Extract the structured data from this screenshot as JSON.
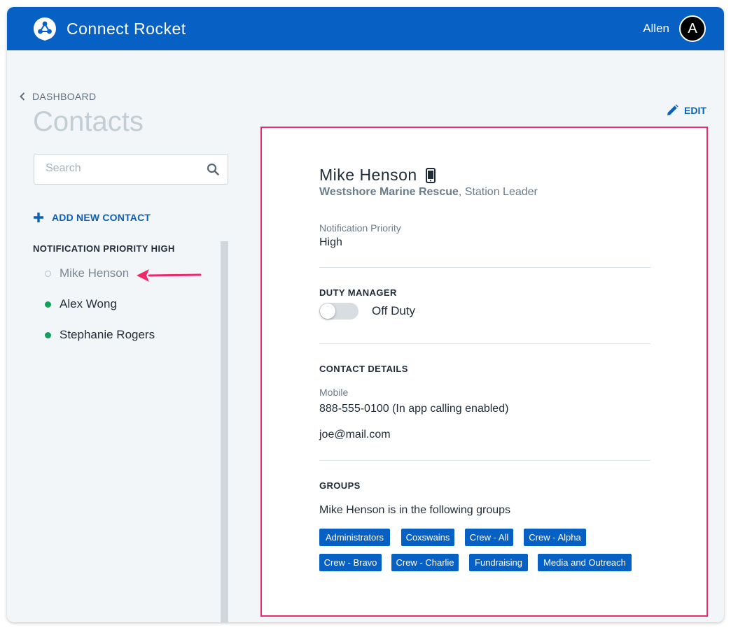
{
  "header": {
    "app_title": "Connect Rocket",
    "user_name": "Allen",
    "avatar_initial": "A",
    "brand_color": "#0760c4"
  },
  "nav": {
    "back_label": "DASHBOARD",
    "page_title": "Contacts"
  },
  "search": {
    "placeholder": "Search",
    "value": ""
  },
  "add_contact_label": "ADD NEW CONTACT",
  "contact_list": {
    "section_label": "NOTIFICATION PRIORITY HIGH",
    "items": [
      {
        "name": "Mike Henson",
        "status": "off"
      },
      {
        "name": "Alex Wong",
        "status": "on"
      },
      {
        "name": "Stephanie Rogers",
        "status": "on"
      }
    ]
  },
  "edit_label": "EDIT",
  "detail": {
    "name": "Mike Henson",
    "organization": "Westshore Marine Rescue",
    "role": ", Station Leader",
    "notification_priority_label": "Notification Priority",
    "notification_priority_value": "High",
    "duty_manager_heading": "DUTY MANAGER",
    "duty_status": "Off Duty",
    "contact_details_heading": "CONTACT DETAILS",
    "mobile_label": "Mobile",
    "mobile_value": "888-555-0100 (In app calling enabled)",
    "email": "joe@mail.com",
    "groups_heading": "GROUPS",
    "groups_intro": "Mike Henson is in the following groups",
    "groups": [
      "Administrators",
      "Coxswains",
      "Crew - All",
      "Crew - Alpha",
      "Crew - Bravo",
      "Crew - Charlie",
      "Fundraising",
      "Media and Outreach"
    ]
  },
  "colors": {
    "accent": "#0d5fb8",
    "highlight_border": "#ea2a6a",
    "online_dot": "#13a05a"
  }
}
